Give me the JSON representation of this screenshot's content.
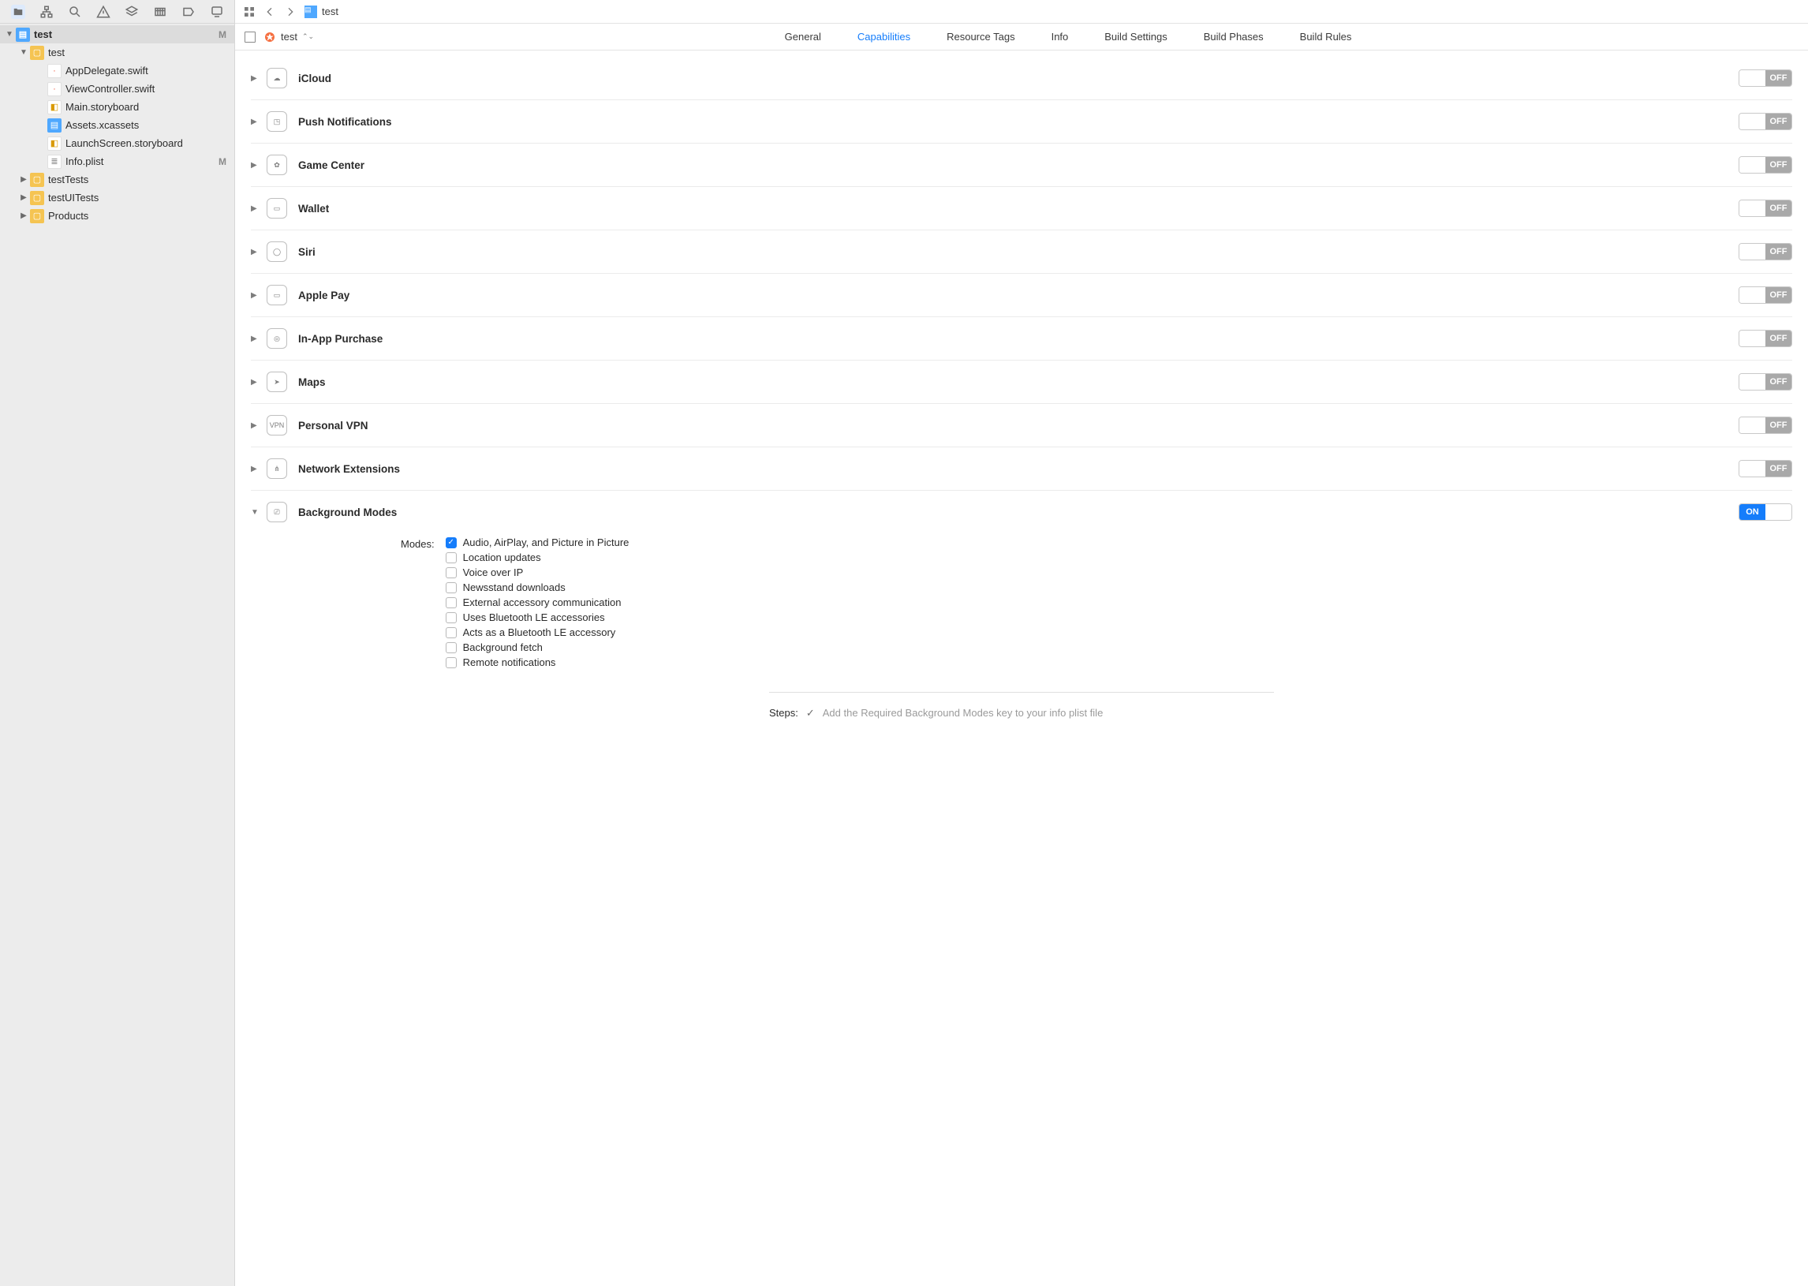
{
  "navigator": {
    "root": {
      "name": "test",
      "badge": "M"
    },
    "items": [
      {
        "indent": 1,
        "disclosure": "▼",
        "icon": "folder",
        "label": "test"
      },
      {
        "indent": 2,
        "disclosure": "",
        "icon": "swift",
        "label": "AppDelegate.swift"
      },
      {
        "indent": 2,
        "disclosure": "",
        "icon": "swift",
        "label": "ViewController.swift"
      },
      {
        "indent": 2,
        "disclosure": "",
        "icon": "story",
        "label": "Main.storyboard"
      },
      {
        "indent": 2,
        "disclosure": "",
        "icon": "assets",
        "label": "Assets.xcassets"
      },
      {
        "indent": 2,
        "disclosure": "",
        "icon": "story",
        "label": "LaunchScreen.storyboard"
      },
      {
        "indent": 2,
        "disclosure": "",
        "icon": "plist",
        "label": "Info.plist",
        "badge": "M"
      },
      {
        "indent": 1,
        "disclosure": "▶",
        "icon": "folder",
        "label": "testTests"
      },
      {
        "indent": 1,
        "disclosure": "▶",
        "icon": "folder",
        "label": "testUITests"
      },
      {
        "indent": 1,
        "disclosure": "▶",
        "icon": "folder",
        "label": "Products"
      }
    ]
  },
  "jumpbar": {
    "crumb": "test"
  },
  "target": {
    "name": "test"
  },
  "tabs": [
    {
      "label": "General"
    },
    {
      "label": "Capabilities",
      "active": true
    },
    {
      "label": "Resource Tags"
    },
    {
      "label": "Info"
    },
    {
      "label": "Build Settings"
    },
    {
      "label": "Build Phases"
    },
    {
      "label": "Build Rules"
    }
  ],
  "toggle_labels": {
    "on": "ON",
    "off": "OFF"
  },
  "capabilities": [
    {
      "name": "iCloud",
      "state": "off",
      "expanded": false,
      "icon": "cloud"
    },
    {
      "name": "Push Notifications",
      "state": "off",
      "expanded": false,
      "icon": "push"
    },
    {
      "name": "Game Center",
      "state": "off",
      "expanded": false,
      "icon": "game"
    },
    {
      "name": "Wallet",
      "state": "off",
      "expanded": false,
      "icon": "wallet"
    },
    {
      "name": "Siri",
      "state": "off",
      "expanded": false,
      "icon": "siri"
    },
    {
      "name": "Apple Pay",
      "state": "off",
      "expanded": false,
      "icon": "applepay"
    },
    {
      "name": "In-App Purchase",
      "state": "off",
      "expanded": false,
      "icon": "iap"
    },
    {
      "name": "Maps",
      "state": "off",
      "expanded": false,
      "icon": "maps"
    },
    {
      "name": "Personal VPN",
      "state": "off",
      "expanded": false,
      "icon": "vpn"
    },
    {
      "name": "Network Extensions",
      "state": "off",
      "expanded": false,
      "icon": "netext"
    },
    {
      "name": "Background Modes",
      "state": "on",
      "expanded": true,
      "icon": "bgmodes"
    }
  ],
  "background_modes": {
    "section_label": "Modes:",
    "items": [
      {
        "label": "Audio, AirPlay, and Picture in Picture",
        "checked": true
      },
      {
        "label": "Location updates",
        "checked": false
      },
      {
        "label": "Voice over IP",
        "checked": false
      },
      {
        "label": "Newsstand downloads",
        "checked": false
      },
      {
        "label": "External accessory communication",
        "checked": false
      },
      {
        "label": "Uses Bluetooth LE accessories",
        "checked": false
      },
      {
        "label": "Acts as a Bluetooth LE accessory",
        "checked": false
      },
      {
        "label": "Background fetch",
        "checked": false
      },
      {
        "label": "Remote notifications",
        "checked": false
      }
    ],
    "steps_label": "Steps:",
    "steps_text": "Add the Required Background Modes key to your info plist file"
  }
}
